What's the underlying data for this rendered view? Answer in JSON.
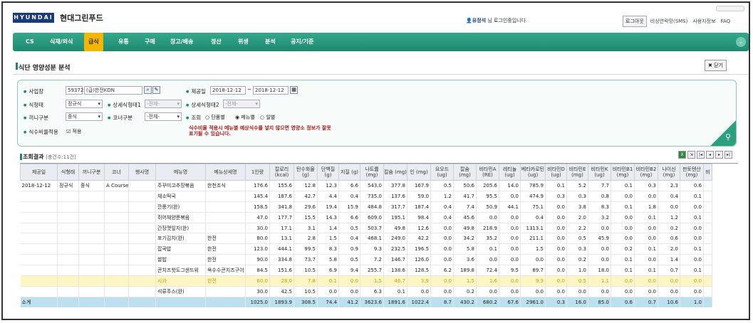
{
  "header": {
    "logo": "HYUNDAI",
    "company": "현대그린푸드",
    "user_name": "유정석",
    "login_text": " 님 로그인중입니다.",
    "logout": "로그아웃",
    "links": [
      "비상연락망(SMS)",
      "사용자정보",
      "FAQ"
    ]
  },
  "nav": {
    "items": [
      "CS",
      "식재/외식",
      "급식",
      "유통",
      "구매",
      "창고/배송",
      "정산",
      "위생",
      "분석",
      "공지/기준"
    ],
    "active": "급식"
  },
  "page": {
    "title": "식단 영양성분 분석",
    "close": "닫기"
  },
  "search": {
    "site_label": "사업장",
    "site_code": "59372",
    "site_name": "(급)한전KDN",
    "date_label": "제공일",
    "date_from": "2018-12-12",
    "date_sep": "~",
    "date_to": "2018-12-12",
    "type_label": "식형태",
    "type_value": "정규식",
    "detail1_label": "상세식형태1",
    "detail1_value": "-전체-",
    "detail2_label": "상세식형태2",
    "detail2_value": "-전체-",
    "meal_label": "끼니구분",
    "meal_value": "중식",
    "corner_label": "코너구분",
    "corner_value": "-전체-",
    "view_label": "조회",
    "view_options": [
      "단품별",
      "메뉴별",
      "일별"
    ],
    "view_selected": "메뉴별",
    "ratio_label": "식수비율적용",
    "ratio_check": "적용",
    "notice": "식수비율 적용시 메뉴별 예상식수를 넣지 않으면 영양소 정보가 잘못 표기될 수 있습니다."
  },
  "result": {
    "title": "조회결과",
    "count": "[총건수:11건]"
  },
  "table": {
    "headers": [
      "제공일",
      "식형태",
      "끼니구분",
      "코너",
      "행사명",
      "메뉴명",
      "메뉴상세명",
      "1인량",
      "칼로리 (kcal)",
      "탄수화물 (g)",
      "단백질 (g)",
      "지질 (g)",
      "나트륨 (mg)",
      "칼슘 (mg)",
      "인 (mg)",
      "요오드 (ug)",
      "칼슘 (mg)",
      "비타민A (RE)",
      "레티놀 (ug)",
      "베타카로틴 (ug)",
      "비타민D (ug)",
      "비타민E (mg)",
      "비타민K (ug)",
      "비타민B1 (mg)",
      "비타민B2 (mg)",
      "나이신 (mg)",
      "판토텐산 (mg)",
      "비"
    ],
    "rows": [
      [
        "2018-12-12",
        "정규식",
        "중식",
        "A Course",
        "",
        "주꾸미고추장볶음",
        "한천조식",
        "176.6",
        "155.6",
        "12.8",
        "12.3",
        "6.6",
        "543.0",
        "377.8",
        "167.9",
        "0.5",
        "50.6",
        "205.6",
        "14.0",
        "785.9",
        "0.1",
        "5.2",
        "7.7",
        "0.1",
        "0.3",
        "2.3",
        "0.6"
      ],
      [
        "",
        "",
        "",
        "",
        "",
        "채소떡국",
        "",
        "145.4",
        "187.6",
        "42.7",
        "4.4",
        "0.4",
        "735.0",
        "137.6",
        "59.0",
        "1.2",
        "41.7",
        "95.5",
        "0.0",
        "474.9",
        "0.3",
        "0.3",
        "0.8",
        "0.0",
        "0.0",
        "0.4",
        "0.1"
      ],
      [
        "",
        "",
        "",
        "",
        "",
        "깐풍기(완)",
        "",
        "158.5",
        "341.8",
        "29.6",
        "19.4",
        "15.9",
        "484.8",
        "317.7",
        "187.4",
        "0.4",
        "7.4",
        "50.9",
        "44.1",
        "75.1",
        "0.0",
        "3.8",
        "8.3",
        "0.1",
        "1.8",
        "0.0",
        "0.0"
      ],
      [
        "",
        "",
        "",
        "",
        "",
        "쥐어채양푼볶음",
        "",
        "47.0",
        "177.7",
        "15.5",
        "14.3",
        "6.6",
        "609.0",
        "195.1",
        "98.4",
        "0.4",
        "45.6",
        "0.0",
        "0.0",
        "0.4",
        "0.0",
        "2.0",
        "3.2",
        "0.0",
        "0.1",
        "1.2",
        "0.1"
      ],
      [
        "",
        "",
        "",
        "",
        "",
        "간장깻잎지(완)",
        "",
        "30.0",
        "17.1",
        "3.1",
        "1.4",
        "0.5",
        "503.7",
        "49.8",
        "12.6",
        "0.0",
        "49.8",
        "218.9",
        "0.0",
        "1313.1",
        "0.0",
        "2.2",
        "0.0",
        "0.0",
        "0.0",
        "0.2",
        "0.0"
      ],
      [
        "",
        "",
        "",
        "",
        "",
        "포기김치(완)",
        "한전",
        "80.0",
        "13.1",
        "2.8",
        "1.5",
        "0.4",
        "468.1",
        "249.0",
        "42.2",
        "0.0",
        "34.2",
        "35.2",
        "0.0",
        "211.1",
        "0.0",
        "0.5",
        "45.9",
        "0.0",
        "0.0",
        "0.6",
        "0.0"
      ],
      [
        "",
        "",
        "",
        "",
        "",
        "잡곡밥",
        "한전",
        "123.0",
        "444.1",
        "99.5",
        "8.3",
        "0.9",
        "9.3",
        "232.5",
        "196.5",
        "0.0",
        "5.8",
        "0.1",
        "0.0",
        "1.5",
        "0.0",
        "0.3",
        "0.0",
        "0.2",
        "0.1",
        "2.0",
        "0.1"
      ],
      [
        "",
        "",
        "",
        "",
        "",
        "쌀밥",
        "한전",
        "90.0",
        "334.8",
        "73.7",
        "5.8",
        "0.5",
        "7.2",
        "146.7",
        "126.0",
        "0.0",
        "3.6",
        "0.0",
        "0.0",
        "0.0",
        "0.0",
        "0.2",
        "0.0",
        "0.1",
        "0.0",
        "1.4",
        "0.0"
      ],
      [
        "",
        "",
        "",
        "",
        "",
        "콘치즈핫도그샌드위",
        "옥수수콘치즈구이",
        "84.5",
        "151.6",
        "10.5",
        "6.9",
        "9.4",
        "255.7",
        "138.6",
        "128.5",
        "6.2",
        "189.8",
        "72.4",
        "9.5",
        "89.7",
        "0.0",
        "1.0",
        "18.0",
        "0.1",
        "0.1",
        "0.7",
        "0.1"
      ],
      [
        "",
        "",
        "",
        "",
        "",
        "사과",
        "한전",
        "60.0",
        "28.0",
        "7.8",
        "0.1",
        "0.0",
        "1.5",
        "46.7",
        "3.9",
        "0.0",
        "1.5",
        "1.6",
        "0.0",
        "9.3",
        "0.0",
        "0.5",
        "1.1",
        "0.0",
        "0.0",
        "0.0",
        "0.0"
      ],
      [
        "",
        "",
        "",
        "",
        "",
        "석류주스(완)",
        "",
        "30.0",
        "42.5",
        "10.5",
        "0.0",
        "0.0",
        "6.3",
        "0.1",
        "0.0",
        "0.0",
        "0.2",
        "0.0",
        "0.0",
        "0.0",
        "0.0",
        "0.0",
        "0.0",
        "0.0",
        "0.0",
        "0.0",
        "0.0"
      ]
    ],
    "total": [
      "소계",
      "",
      "",
      "",
      "",
      "",
      "",
      "1025.0",
      "1893.9",
      "308.5",
      "74.4",
      "41.2",
      "3623.6",
      "1891.6",
      "1022.4",
      "8.7",
      "430.2",
      "680.2",
      "67.6",
      "2961.0",
      "0.3",
      "16.0",
      "85.0",
      "0.6",
      "0.7",
      "10.6",
      "1.0"
    ]
  },
  "colors": {
    "nav": "#1d8a6f",
    "active_tab": "#f6b600",
    "highlight_row": "#fdf6c3",
    "total_row": "#bde0ef"
  }
}
